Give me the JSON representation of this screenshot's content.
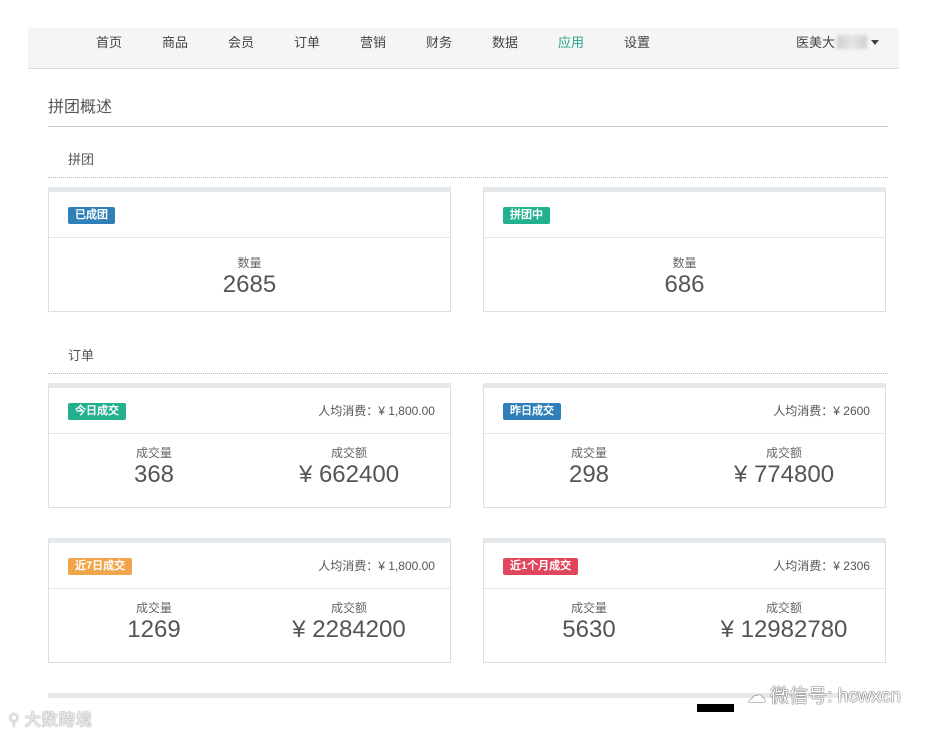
{
  "nav": {
    "items": [
      {
        "label": "首页"
      },
      {
        "label": "商品"
      },
      {
        "label": "会员"
      },
      {
        "label": "订单"
      },
      {
        "label": "营销"
      },
      {
        "label": "财务"
      },
      {
        "label": "数据"
      },
      {
        "label": "应用",
        "active": true
      },
      {
        "label": "设置"
      }
    ],
    "user": {
      "name": "医美大"
    }
  },
  "page": {
    "title": "拼团概述"
  },
  "groupbuy": {
    "section_label": "拼团",
    "cards": [
      {
        "badge": "已成团",
        "badge_color": "#2f7fb8",
        "metric_label": "数量",
        "metric_value": "2685"
      },
      {
        "badge": "拼团中",
        "badge_color": "#22b08e",
        "metric_label": "数量",
        "metric_value": "686"
      }
    ]
  },
  "orders": {
    "section_label": "订单",
    "cards": [
      {
        "badge": "今日成交",
        "badge_color": "#22b08e",
        "avg": "人均消费：¥ 1,800.00",
        "volume_label": "成交量",
        "volume": "368",
        "amount_label": "成交额",
        "amount": "¥ 662400"
      },
      {
        "badge": "昨日成交",
        "badge_color": "#2f7fb8",
        "avg": "人均消费：¥ 2600",
        "volume_label": "成交量",
        "volume": "298",
        "amount_label": "成交额",
        "amount": "¥ 774800"
      },
      {
        "badge": "近7日成交",
        "badge_color": "#f0a54a",
        "avg": "人均消费：¥ 1,800.00",
        "volume_label": "成交量",
        "volume": "1269",
        "amount_label": "成交额",
        "amount": "¥ 2284200"
      },
      {
        "badge": "近1个月成交",
        "badge_color": "#e0475c",
        "avg": "人均消费：¥ 2306",
        "volume_label": "成交量",
        "volume": "5630",
        "amount_label": "成交额",
        "amount": "¥ 12982780"
      }
    ]
  },
  "watermarks": {
    "left": "大数跨境",
    "right": "微信号: hcwxcn"
  }
}
